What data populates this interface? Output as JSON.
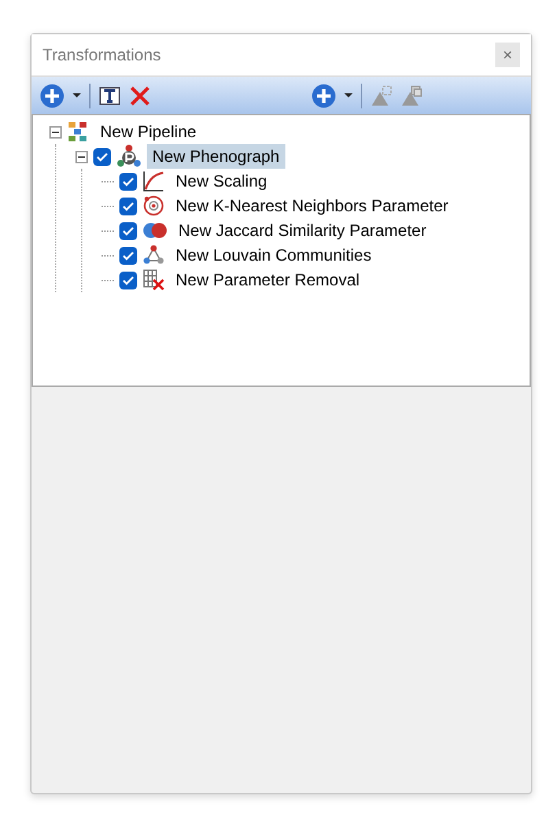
{
  "window": {
    "title": "Transformations",
    "close": "×"
  },
  "tree": [
    {
      "label": "New Pipeline",
      "kind": "pipeline",
      "expanded": true,
      "selected": false,
      "children": [
        {
          "label": "New Phenograph",
          "kind": "phenograph",
          "checked": true,
          "expanded": true,
          "selected": true,
          "children": [
            {
              "label": "New Scaling",
              "kind": "scaling",
              "checked": true,
              "selected": false
            },
            {
              "label": "New K-Nearest Neighbors Parameter",
              "kind": "knn",
              "checked": true,
              "selected": false
            },
            {
              "label": "New Jaccard Similarity Parameter",
              "kind": "jaccard",
              "checked": true,
              "selected": false
            },
            {
              "label": "New Louvain Communities",
              "kind": "louvain",
              "checked": true,
              "selected": false
            },
            {
              "label": "New Parameter Removal",
              "kind": "removal",
              "checked": true,
              "selected": false
            }
          ]
        }
      ]
    }
  ]
}
